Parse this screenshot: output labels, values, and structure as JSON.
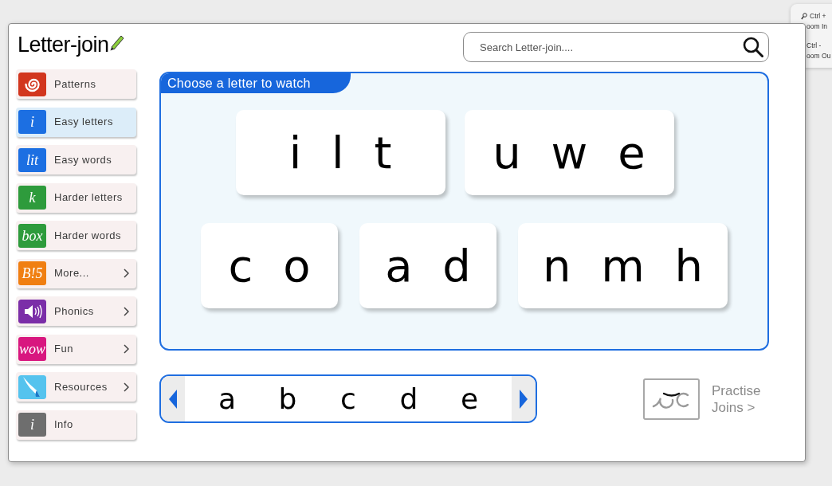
{
  "zoom_popup": {
    "lines": [
      {
        "text": "Ctrl +",
        "icon": true
      },
      {
        "text": "oom In",
        "icon": false
      },
      {
        "text": "Ctrl -",
        "icon": false
      },
      {
        "text": "oom Ou",
        "icon": false
      }
    ]
  },
  "logo": {
    "text": "Letter-join"
  },
  "search": {
    "placeholder": "Search Letter-join...."
  },
  "sidebar": {
    "items": [
      {
        "label": "Patterns",
        "kind": "spiral",
        "color": "#d2361e",
        "selected": false,
        "submenu": false
      },
      {
        "label": "Easy letters",
        "kind": "lettered",
        "tile_text": "i",
        "color": "#1c6fe2",
        "selected": true,
        "submenu": false
      },
      {
        "label": "Easy words",
        "kind": "lettered",
        "tile_text": "lit",
        "color": "#1c6fe2",
        "selected": false,
        "submenu": false
      },
      {
        "label": "Harder letters",
        "kind": "lettered",
        "tile_text": "k",
        "color": "#2e9b3c",
        "selected": false,
        "submenu": false
      },
      {
        "label": "Harder words",
        "kind": "lettered",
        "tile_text": "box",
        "color": "#2e9b3c",
        "selected": false,
        "submenu": false
      },
      {
        "label": "More...",
        "kind": "lettered",
        "tile_text": "B!5",
        "color": "#f07f12",
        "selected": false,
        "submenu": true
      },
      {
        "label": "Phonics",
        "kind": "speaker",
        "color": "#7b2ea8",
        "selected": false,
        "submenu": true
      },
      {
        "label": "Fun",
        "kind": "lettered",
        "tile_text": "wow",
        "color": "#d8177f",
        "selected": false,
        "submenu": true
      },
      {
        "label": "Resources",
        "kind": "page-curl",
        "color": "#55c3ee",
        "selected": false,
        "submenu": true
      },
      {
        "label": "Info",
        "kind": "lettered",
        "tile_text": "i",
        "color": "#6e6e6e",
        "selected": false,
        "submenu": false
      }
    ]
  },
  "letter_panel": {
    "title": "Choose a letter to watch",
    "rows": [
      {
        "groups": [
          "i l t",
          "u w e"
        ]
      },
      {
        "groups": [
          "c o",
          "a d",
          "n m h"
        ]
      }
    ]
  },
  "letter_strip": {
    "letters": [
      "a",
      "b",
      "c",
      "d",
      "e"
    ]
  },
  "practise_joins": {
    "label": "Practise Joins >"
  }
}
